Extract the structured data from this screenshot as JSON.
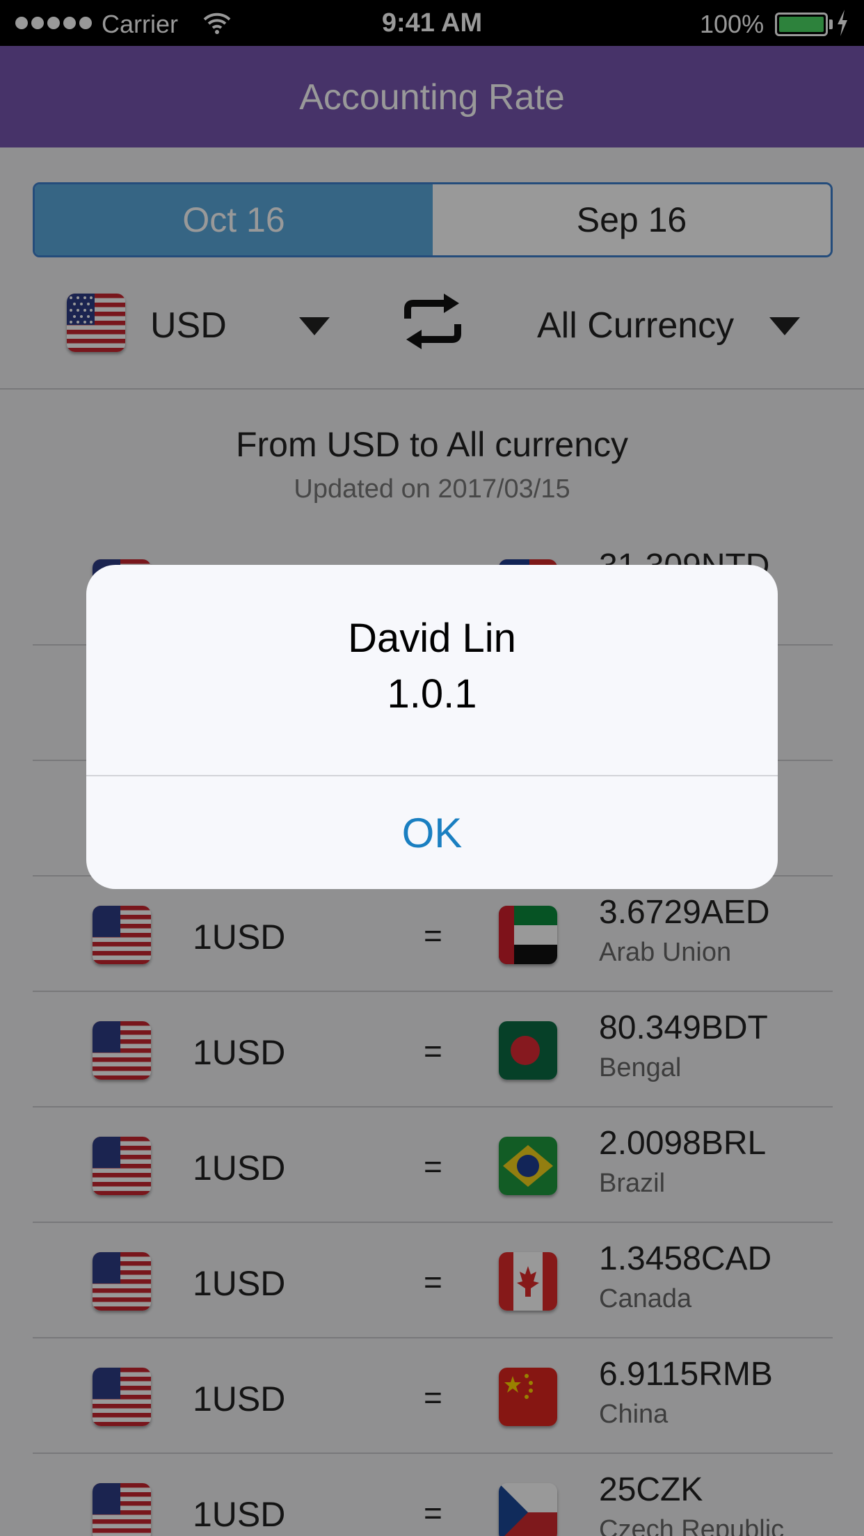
{
  "status_bar": {
    "carrier": "Carrier",
    "time": "9:41 AM",
    "battery_percent": "100%",
    "battery_level": 1.0
  },
  "nav": {
    "title": "Accounting Rate"
  },
  "date_tabs": [
    {
      "label": "Oct 16",
      "selected": true
    },
    {
      "label": "Sep 16",
      "selected": false
    }
  ],
  "selector": {
    "from_currency": "USD",
    "from_flag": "us-flag",
    "swap_icon": "swap-arrows-icon",
    "to_currency": "All Currency"
  },
  "info": {
    "title": "From USD to All currency",
    "updated": "Updated on 2017/03/15"
  },
  "rates": [
    {
      "from": "",
      "eq": "",
      "amount": "31.309NTD",
      "country": "",
      "flag": "taiwan"
    },
    {
      "from": "",
      "eq": "",
      "amount": "",
      "country": "",
      "flag": ""
    },
    {
      "from": "",
      "eq": "",
      "amount": "",
      "country": "",
      "flag": ""
    },
    {
      "from": "1USD",
      "eq": "=",
      "amount": "3.6729AED",
      "country": "Arab Union",
      "flag": "uae"
    },
    {
      "from": "1USD",
      "eq": "=",
      "amount": "80.349BDT",
      "country": "Bengal",
      "flag": "bangladesh"
    },
    {
      "from": "1USD",
      "eq": "=",
      "amount": "2.0098BRL",
      "country": "Brazil",
      "flag": "brazil"
    },
    {
      "from": "1USD",
      "eq": "=",
      "amount": "1.3458CAD",
      "country": "Canada",
      "flag": "canada"
    },
    {
      "from": "1USD",
      "eq": "=",
      "amount": "6.9115RMB",
      "country": "China",
      "flag": "china"
    },
    {
      "from": "1USD",
      "eq": "=",
      "amount": "25CZK",
      "country": "Czech Republic",
      "flag": "czech"
    }
  ],
  "alert": {
    "title": "David Lin",
    "message": "1.0.1",
    "ok_label": "OK"
  },
  "colors": {
    "nav_purple": "#7756b0",
    "segment_blue": "#5aa9dd",
    "segment_border": "#3d7fce",
    "ok_blue": "#1a7fc1"
  }
}
